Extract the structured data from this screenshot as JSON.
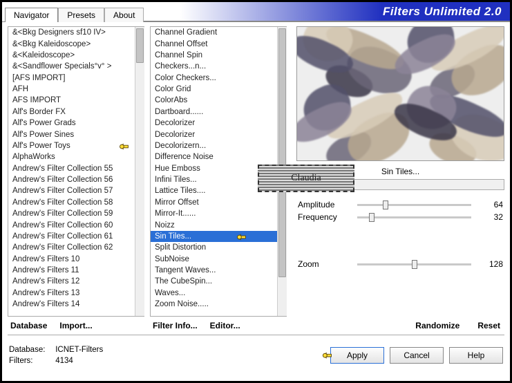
{
  "app": {
    "title": "Filters Unlimited 2.0"
  },
  "tabs": {
    "navigator": "Navigator",
    "presets": "Presets",
    "about": "About"
  },
  "categories": [
    "&<Bkg Designers sf10 IV>",
    "&<Bkg Kaleidoscope>",
    "&<Kaleidoscope>",
    "&<Sandflower Specials°v° >",
    "[AFS IMPORT]",
    "AFH",
    "AFS IMPORT",
    "Alf's Border FX",
    "Alf's Power Grads",
    "Alf's Power Sines",
    "Alf's Power Toys",
    "AlphaWorks",
    "Andrew's Filter Collection 55",
    "Andrew's Filter Collection 56",
    "Andrew's Filter Collection 57",
    "Andrew's Filter Collection 58",
    "Andrew's Filter Collection 59",
    "Andrew's Filter Collection 60",
    "Andrew's Filter Collection 61",
    "Andrew's Filter Collection 62",
    "Andrew's Filters 10",
    "Andrew's Filters 11",
    "Andrew's Filters 12",
    "Andrew's Filters 13",
    "Andrew's Filters 14"
  ],
  "category_pointer_index": 10,
  "filters": [
    "Channel Gradient",
    "Channel Offset",
    "Channel Spin",
    "Checkers...n...",
    "Color Checkers...",
    "Color Grid",
    "ColorAbs",
    "Dartboard......",
    "Decolorizer",
    "Decolorizer",
    "Decolorizern...",
    "Difference Noise",
    "Hue Emboss",
    "Infini Tiles...",
    "Lattice Tiles....",
    "Mirror Offset",
    "Mirror-It......",
    "Noizz",
    "Sin Tiles...",
    "Split Distortion",
    "SubNoise",
    "Tangent Waves...",
    "The CubeSpin...",
    "Waves...",
    "Zoom Noise....."
  ],
  "filter_selected_index": 18,
  "selected_filter_name": "Sin Tiles...",
  "params": {
    "amplitude": {
      "label": "Amplitude",
      "value": 64,
      "max": 255
    },
    "frequency": {
      "label": "Frequency",
      "value": 32,
      "max": 255
    },
    "zoom": {
      "label": "Zoom",
      "value": 128,
      "max": 255
    }
  },
  "buttons": {
    "database": "Database",
    "import": "Import...",
    "filter_info": "Filter Info...",
    "editor": "Editor...",
    "randomize": "Randomize",
    "reset": "Reset",
    "apply": "Apply",
    "cancel": "Cancel",
    "help": "Help"
  },
  "status": {
    "database_label": "Database:",
    "database_value": "ICNET-Filters",
    "filters_label": "Filters:",
    "filters_value": "4134"
  },
  "watermark": "Claudia"
}
